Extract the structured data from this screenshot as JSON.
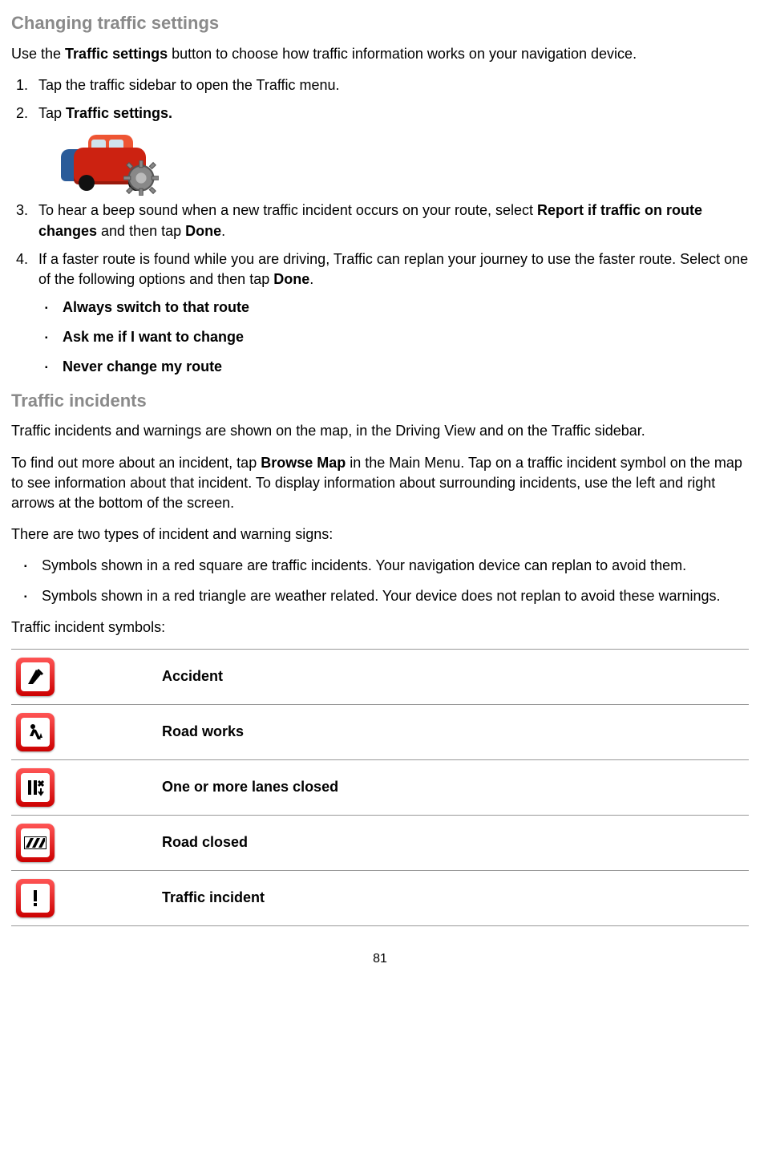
{
  "section1": {
    "title": "Changing traffic settings",
    "intro_pre": "Use the ",
    "intro_bold": "Traffic settings",
    "intro_post": " button to choose how traffic information works on your navigation device.",
    "step1": "Tap the traffic sidebar to open the Traffic menu.",
    "step2_pre": "Tap ",
    "step2_bold": "Traffic settings.",
    "step3_pre": "To hear a beep sound when a new traffic incident occurs on your route, select ",
    "step3_bold1": "Report if traffic on route changes",
    "step3_mid": " and then tap ",
    "step3_bold2": "Done",
    "step3_post": ".",
    "step4_pre": "If a faster route is found while you are driving, Traffic can replan your journey to use the faster route. Select one of the following options and then tap ",
    "step4_bold": "Done",
    "step4_post": ".",
    "opt1": "Always switch to that route",
    "opt2": "Ask me if I want to change",
    "opt3": "Never change my route"
  },
  "section2": {
    "title": "Traffic incidents",
    "para1": "Traffic incidents and warnings are shown on the map, in the Driving View and on the Traffic sidebar.",
    "para2_pre": "To find out more about an incident, tap ",
    "para2_bold": "Browse Map",
    "para2_post": " in the Main Menu. Tap on a traffic incident symbol on the map to see information about that incident. To display information about surrounding incidents, use the left and right arrows at the bottom of the screen.",
    "para3": "There are two types of incident and warning signs:",
    "bullet1": "Symbols shown in a red square are traffic incidents. Your navigation device can replan to avoid them.",
    "bullet2": "Symbols shown in a red triangle are weather related. Your device does not replan to avoid these warnings.",
    "tablecaption": "Traffic incident symbols:",
    "rows": {
      "accident": "Accident",
      "roadworks": "Road works",
      "lanes": "One or more lanes closed",
      "closed": "Road closed",
      "incident": "Traffic incident"
    }
  },
  "page_number": "81"
}
